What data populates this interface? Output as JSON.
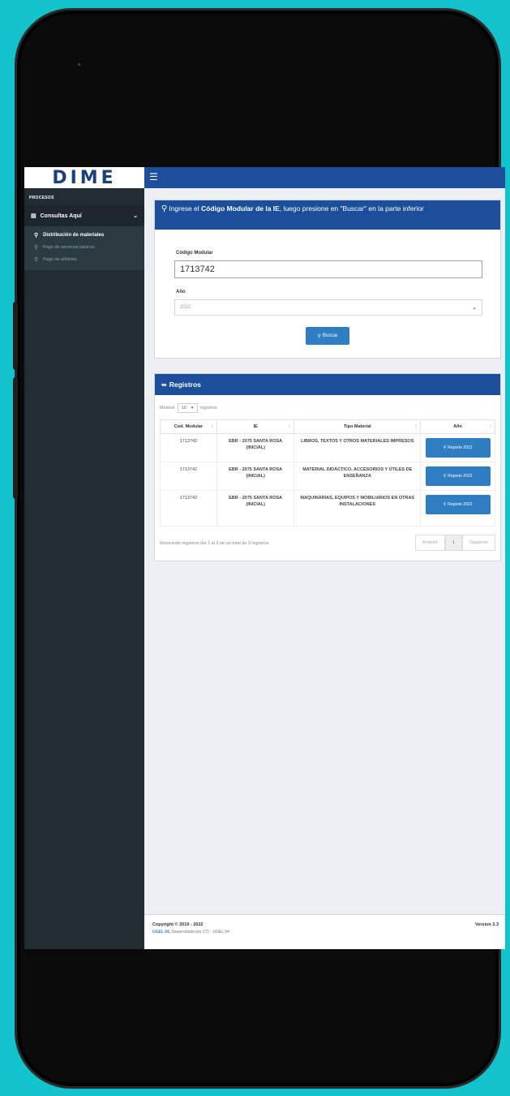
{
  "header": {
    "logo": "DIME",
    "menu_icon": "hamburger-icon"
  },
  "sidebar": {
    "section_label": "PROCESOS",
    "main_item": {
      "label": "Consultas Aquí",
      "icon": "bar-chart-icon"
    },
    "items": [
      {
        "label": "Distribución de materiales",
        "icon": "search-icon",
        "active": true
      },
      {
        "label": "Pago de servicios básicos",
        "icon": "search-icon",
        "active": false
      },
      {
        "label": "Pago de arbitrios",
        "icon": "search-icon",
        "active": false
      }
    ]
  },
  "search_box": {
    "title_pre": "Ingrese el ",
    "title_bold": "Código Modular de la IE",
    "title_post": ", luego presione en \"Buscar\" en la parte inferior",
    "codigo_label": "Código Modular",
    "codigo_value": "1713742",
    "year_label": "Año",
    "year_value": "2022",
    "button_label": "Buscar"
  },
  "results_box": {
    "title": "Registros",
    "show_label": "Mostrar",
    "show_value": "10",
    "records_label": "registros",
    "columns": [
      "Cod. Modular",
      "IE",
      "Tipo Material",
      "Año"
    ],
    "rows": [
      {
        "cod": "1713742",
        "ie": "EBR - 2075 SANTA ROSA (INICIAL)",
        "tipo": "LIBROS, TEXTOS Y OTROS MATERIALES IMPRESOS",
        "btn": "Reporte 2022"
      },
      {
        "cod": "1713742",
        "ie": "EBR - 2075 SANTA ROSA (INICIAL)",
        "tipo": "MATERIAL DIDÁCTICO, ACCESORIOS Y ÚTILES DE ENSEÑANZA",
        "btn": "Reporte 2022"
      },
      {
        "cod": "1713742",
        "ie": "EBR - 2075 SANTA ROSA (INICIAL)",
        "tipo": "MAQUINARIAS, EQUIPOS Y MOBILIARIOS EN OTRAS INSTALACIONES",
        "btn": "Reporte 2022"
      }
    ],
    "info": "Mostrando registros del 1 al 3 de un total de 3 registros",
    "pager": {
      "prev": "Anterior",
      "current": "1",
      "next": "Siguiente"
    }
  },
  "footer": {
    "copyright": "Copyright © 2019 - 2022",
    "org": "UGEL 04,",
    "credit": " Desarrollado por CTI - UGEL 04",
    "version": "Version 2.3"
  }
}
